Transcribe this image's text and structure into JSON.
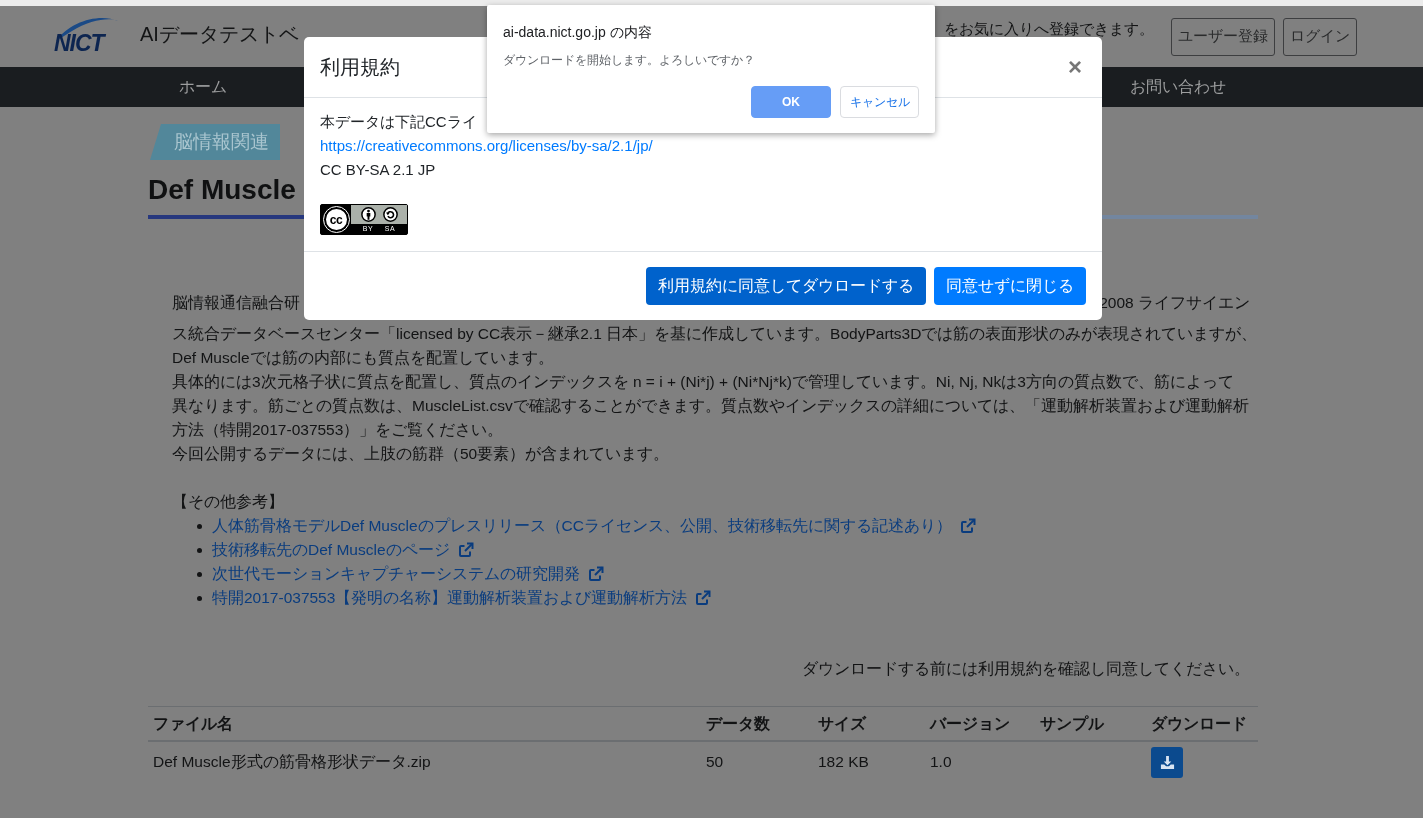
{
  "header": {
    "logo_text": "NICT",
    "site_title": "AIデータテストベ",
    "notice_fragment": "をお気に入りへ登録できます。",
    "buttons": [
      {
        "label": "ユーザー登録"
      },
      {
        "label": "ログイン"
      }
    ]
  },
  "nav": [
    {
      "label": "ホーム"
    },
    {
      "label": "お問い合わせ"
    }
  ],
  "page": {
    "category_tag": "脳情報関連",
    "title": "Def Muscle",
    "intro_fragments": [
      "脳情報通信融合研",
      "2008 ライフサイエン"
    ],
    "paragraphs": [
      {
        "lines": [
          "ス統合データベースセンター「licensed by CC表示－継承2.1 日本」を基に作成しています。BodyParts3Dでは筋の表面形状のみが表現されていますが、",
          "Def Muscleでは筋の内部にも質点を配置しています。"
        ]
      },
      {
        "lines": [
          "具体的には3次元格子状に質点を配置し、質点のインデックスを n = i + (Ni*j) + (Ni*Nj*k)で管理しています。Ni, Nj, Nkは3方向の質点数で、筋によって",
          "異なります。筋ごとの質点数は、MuscleList.csvで確認することができます。質点数やインデックスの詳細については、「運動解析装置および運動解析",
          "方法（特開2017-037553）」をご覧ください。"
        ]
      },
      {
        "lines": [
          "今回公開するデータには、上肢の筋群（50要素）が含まれています。"
        ]
      }
    ],
    "references": {
      "heading": "【その他参考】",
      "links": [
        {
          "label": "人体筋骨格モデルDef Muscleのプレスリリース（CCライセンス、公開、技術移転先に関する記述あり）"
        },
        {
          "label": "技術移転先のDef Muscleのページ"
        },
        {
          "label": "次世代モーションキャプチャーシステムの研究開発"
        },
        {
          "label": "特開2017-037553【発明の名称】運動解析装置および運動解析方法"
        }
      ]
    },
    "download_notice": "ダウンロードする前には利用規約を確認し同意してください。",
    "table": {
      "columns": [
        "ファイル名",
        "データ数",
        "サイズ",
        "バージョン",
        "サンプル",
        "ダウンロード"
      ],
      "rows": [
        {
          "cells": [
            "Def Muscle形式の筋骨格形状データ.zip",
            "50",
            "182 KB",
            "1.0"
          ],
          "download": true
        }
      ]
    }
  },
  "terms_modal": {
    "title": "利用規約",
    "close": "×",
    "body_fragment": "本データは下記CCライ",
    "license_url": "https://creativecommons.org/licenses/by-sa/2.1/jp/",
    "license_name": "CC BY-SA 2.1 JP",
    "badge": {
      "mark": "cc",
      "terms": [
        "BY",
        "SA"
      ]
    },
    "buttons": [
      {
        "label": "利用規約に同意してダウロードする",
        "focused": true
      },
      {
        "label": "同意せずに閉じる",
        "focused": false
      }
    ]
  },
  "confirm_dialog": {
    "title": "ai-data.nict.go.jp の内容",
    "message": "ダウンロードを開始します。よろしいですか？",
    "buttons": [
      {
        "label": "OK",
        "kind": "primary"
      },
      {
        "label": "キャンセル",
        "kind": "secondary"
      }
    ]
  }
}
